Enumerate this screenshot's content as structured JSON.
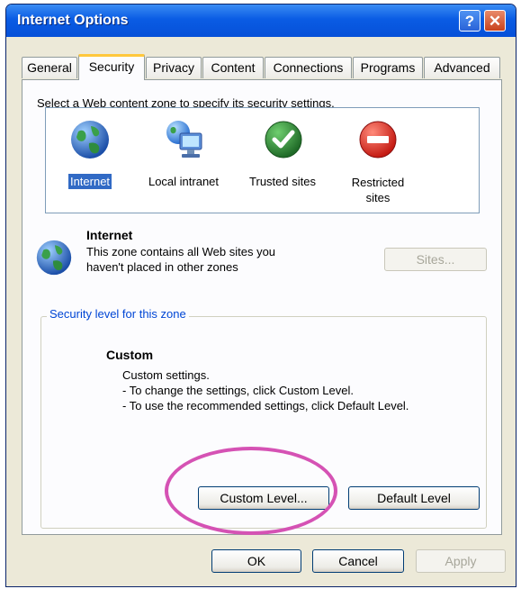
{
  "window": {
    "title": "Internet Options",
    "help": "?",
    "close": "✕"
  },
  "tabs": [
    "General",
    "Security",
    "Privacy",
    "Content",
    "Connections",
    "Programs",
    "Advanced"
  ],
  "active_tab": "Security",
  "instruction": "Select a Web content zone to specify its security settings.",
  "zones": [
    {
      "label": "Internet",
      "icon": "globe-icon",
      "selected": true
    },
    {
      "label": "Local intranet",
      "icon": "intranet-icon",
      "selected": false
    },
    {
      "label": "Trusted sites",
      "icon": "checkmark-icon",
      "selected": false
    },
    {
      "label": "Restricted sites",
      "icon": "restricted-icon",
      "selected": false
    }
  ],
  "zone_info": {
    "title": "Internet",
    "line1": "This zone contains all Web sites you",
    "line2": "haven't placed in other zones",
    "sites_button": "Sites..."
  },
  "security_level": {
    "group_title": "Security level for this zone",
    "level_name": "Custom",
    "line1": "Custom settings.",
    "line2": "- To change the settings, click Custom Level.",
    "line3": "- To use the recommended settings, click Default Level.",
    "custom_button": "Custom Level...",
    "default_button": "Default Level"
  },
  "footer": {
    "ok": "OK",
    "cancel": "Cancel",
    "apply": "Apply"
  },
  "colors": {
    "titlebar": "#0a5ce4",
    "selection": "#316ac5",
    "highlight_circle": "#d552b4",
    "group_title": "#0046d5"
  }
}
